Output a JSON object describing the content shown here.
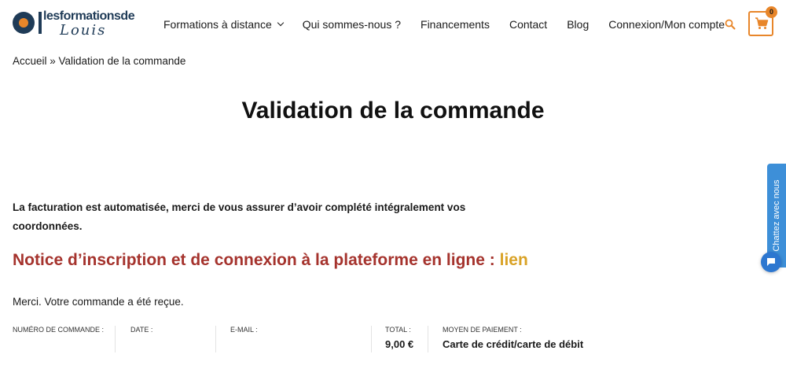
{
  "logo": {
    "top_text": "lesformationsde",
    "bottom_text": "Louis"
  },
  "nav": {
    "items": [
      {
        "label": "Formations à distance",
        "has_dropdown": true
      },
      {
        "label": "Qui sommes-nous ?"
      },
      {
        "label": "Financements"
      },
      {
        "label": "Contact"
      },
      {
        "label": "Blog"
      },
      {
        "label": "Connexion/Mon compte"
      }
    ],
    "search_icon": "search-icon",
    "cart_icon": "shopping-cart-icon",
    "cart_count": "0"
  },
  "breadcrumb": "Accueil » Validation de la commande",
  "page": {
    "title": "Validation de la commande",
    "notice": "La facturation est automatisée, merci de vous assurer d’avoir complété intégralement vos coordonnées.",
    "subheading_text": "Notice d’inscription et de connexion à la plateforme en ligne : ",
    "subheading_link": "lien",
    "thanks": "Merci. Votre commande a été reçue."
  },
  "order_overview": {
    "number_label": "NUMÉRO DE COMMANDE :",
    "number_value": "",
    "date_label": "DATE :",
    "date_value": "",
    "email_label": "E-MAIL :",
    "email_value": "",
    "total_label": "TOTAL :",
    "total_value": "9,00 €",
    "payment_label": "MOYEN DE PAIEMENT :",
    "payment_value": "Carte de crédit/carte de débit"
  },
  "chat": {
    "tab_label": "Chattez avec nous",
    "bubble_icon": "chat-bubble-icon"
  },
  "colors": {
    "accent": "#e8862a",
    "heading_red": "#a5332d",
    "link_gold": "#d9a226",
    "chat_blue": "#3d8fd8",
    "brand_navy": "#1f3b57"
  }
}
